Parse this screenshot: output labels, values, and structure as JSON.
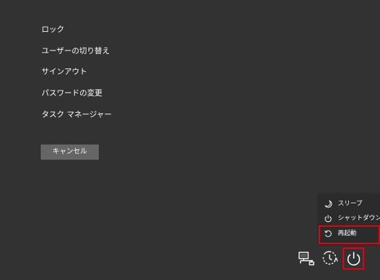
{
  "options_menu": {
    "lock": "ロック",
    "switch_user": "ユーザーの切り替え",
    "sign_out": "サインアウト",
    "change_password": "パスワードの変更",
    "task_manager": "タスク マネージャー"
  },
  "cancel_button": {
    "label": "キャンセル"
  },
  "power_menu": {
    "items": [
      {
        "label": "スリープ",
        "icon": "moon-icon"
      },
      {
        "label": "シャットダウン",
        "icon": "power-icon"
      },
      {
        "label": "再起動",
        "icon": "restart-icon"
      }
    ],
    "highlighted": "再起動"
  },
  "tray": {
    "icons": [
      "network-icon",
      "ease-of-access-icon",
      "power-icon"
    ]
  },
  "colors": {
    "background": "#323232",
    "button": "#666666",
    "menu_background": "#2b2b2b",
    "highlight": "#e60012",
    "text": "#ffffff"
  }
}
